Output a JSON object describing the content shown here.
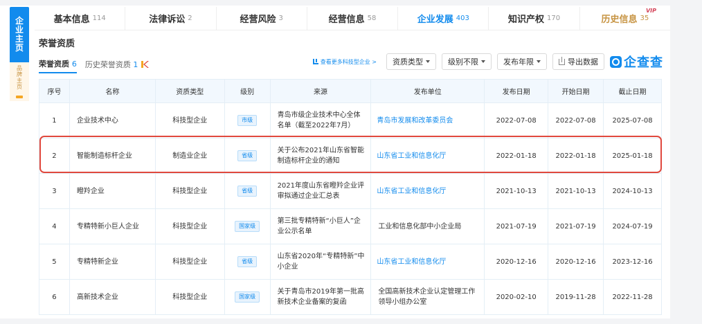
{
  "sidebar": {
    "brand_main": "企业主页",
    "brand_sub": "品牌主页"
  },
  "tabs": [
    {
      "label": "基本信息",
      "count": "114"
    },
    {
      "label": "法律诉讼",
      "count": "2"
    },
    {
      "label": "经营风险",
      "count": "3"
    },
    {
      "label": "经营信息",
      "count": "58"
    },
    {
      "label": "企业发展",
      "count": "403"
    },
    {
      "label": "知识产权",
      "count": "170"
    },
    {
      "label": "历史信息",
      "count": "35",
      "badge": "VIP"
    }
  ],
  "section": {
    "title": "荣誉资质",
    "subtabs": [
      {
        "label": "荣誉资质",
        "count": "6"
      },
      {
        "label": "历史荣誉资质",
        "count": "1"
      }
    ]
  },
  "toolbar": {
    "more_link": "查看更多科技型企业 >",
    "qualification_type": "资质类型",
    "level": "级别不限",
    "publish_year": "发布年限",
    "export": "导出数据",
    "brand": "企查查"
  },
  "table": {
    "headers": [
      "序号",
      "名称",
      "资质类型",
      "级别",
      "来源",
      "发布单位",
      "发布日期",
      "开始日期",
      "截止日期"
    ],
    "rows": [
      {
        "no": "1",
        "name": "企业技术中心",
        "type": "科技型企业",
        "level": "市级",
        "source": "青岛市级企业技术中心全体名单（截至2022年7月）",
        "publisher": "青岛市发展和改革委员会",
        "publisher_link": true,
        "publish_date": "2022-07-08",
        "start_date": "2022-07-08",
        "end_date": "2025-07-08"
      },
      {
        "no": "2",
        "name": "智能制造标杆企业",
        "type": "制造业企业",
        "level": "省级",
        "source": "关于公布2021年山东省智能制造标杆企业的通知",
        "publisher": "山东省工业和信息化厅",
        "publisher_link": true,
        "publish_date": "2022-01-18",
        "start_date": "2022-01-18",
        "end_date": "2025-01-18"
      },
      {
        "no": "3",
        "name": "瞪羚企业",
        "type": "科技型企业",
        "level": "省级",
        "source": "2021年度山东省瞪羚企业评审拟通过企业汇总表",
        "publisher": "山东省工业和信息化厅",
        "publisher_link": true,
        "publish_date": "2021-10-13",
        "start_date": "2021-10-13",
        "end_date": "2024-10-13"
      },
      {
        "no": "4",
        "name": "专精特新小巨人企业",
        "type": "科技型企业",
        "level": "国家级",
        "source": "第三批专精特新“小巨人”企业公示名单",
        "publisher": "工业和信息化部中小企业局",
        "publisher_link": false,
        "publish_date": "2021-07-19",
        "start_date": "2021-07-19",
        "end_date": "2024-07-19"
      },
      {
        "no": "5",
        "name": "专精特新企业",
        "type": "科技型企业",
        "level": "省级",
        "source": "山东省2020年“专精特新”中小企业",
        "publisher": "山东省工业和信息化厅",
        "publisher_link": true,
        "publish_date": "2020-12-16",
        "start_date": "2020-12-16",
        "end_date": "2023-12-16"
      },
      {
        "no": "6",
        "name": "高新技术企业",
        "type": "科技型企业",
        "level": "国家级",
        "source": "关于青岛市2019年第一批高新技术企业备案的复函",
        "publisher": "全国高新技术企业认定管理工作领导小组办公室",
        "publisher_link": false,
        "publish_date": "2020-02-10",
        "start_date": "2019-11-28",
        "end_date": "2022-11-28"
      }
    ]
  },
  "colors": {
    "accent": "#128bed",
    "highlight": "#e0483d",
    "history": "#c79443"
  }
}
